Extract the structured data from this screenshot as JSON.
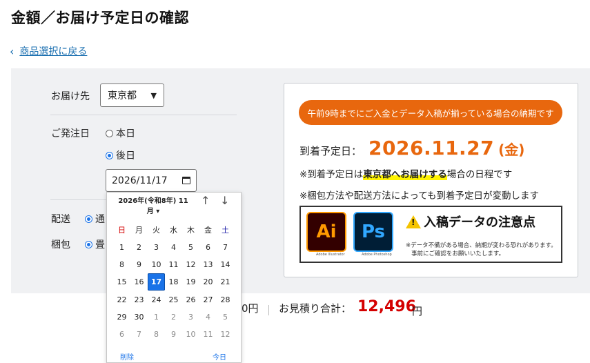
{
  "page": {
    "title": "金額／お届け予定日の確認",
    "back_link": "商品選択に戻る"
  },
  "form": {
    "destination_label": "お届け先",
    "destination_value": "東京都",
    "order_date_label": "ご発注日",
    "order_date_options": [
      "本日",
      "後日"
    ],
    "order_date_selected": "後日",
    "date_value": "2026/11/17",
    "shipping_label": "配送",
    "shipping_value": "通",
    "packing_label": "梱包",
    "packing_value": "畳"
  },
  "delivery": {
    "notice": "午前9時までにご入金とデータ入稿が揃っている場合の納期です",
    "arrival_label": "到着予定日：",
    "arrival_date": "2026.11.27",
    "arrival_day": "(金)",
    "note1_prefix": "※到着予定日は",
    "note1_highlight": "東京都へお届けする",
    "note1_suffix": "場合の日程です",
    "note2": "※梱包方法や配送方法によっても到着予定日が変動します"
  },
  "warning_banner": {
    "ai_label": "Ai",
    "ai_caption": "Adobe Illustrator",
    "ps_label": "Ps",
    "ps_caption": "Adobe Photoshop",
    "title": "入稿データの注意点",
    "sub1": "※データ不備がある場合、納期が変わる恐れがあります。",
    "sub2": "事前にご確認をお願いいたします。"
  },
  "totals": {
    "partial": "0円",
    "estimate_label": "お見積り合計：",
    "estimate_amount": "12,496",
    "estimate_unit": "円"
  },
  "date_picker": {
    "month_label": "2026年(令和8年) 11月 ▾",
    "up_arrow": "↑",
    "down_arrow": "↓",
    "weekdays": [
      "日",
      "月",
      "火",
      "水",
      "木",
      "金",
      "土"
    ],
    "weekday_colors": [
      "#d40000",
      "#222222",
      "#222222",
      "#222222",
      "#222222",
      "#222222",
      "#1a1aa6"
    ],
    "weeks": [
      [
        "1",
        "2",
        "3",
        "4",
        "5",
        "6",
        "7"
      ],
      [
        "8",
        "9",
        "10",
        "11",
        "12",
        "13",
        "14"
      ],
      [
        "15",
        "16",
        "17",
        "18",
        "19",
        "20",
        "21"
      ],
      [
        "22",
        "23",
        "24",
        "25",
        "26",
        "27",
        "28"
      ],
      [
        "29",
        "30",
        "1",
        "2",
        "3",
        "4",
        "5"
      ],
      [
        "6",
        "7",
        "8",
        "9",
        "10",
        "11",
        "12"
      ]
    ],
    "selected_day": "17",
    "clear_label": "削除",
    "today_label": "今日"
  }
}
